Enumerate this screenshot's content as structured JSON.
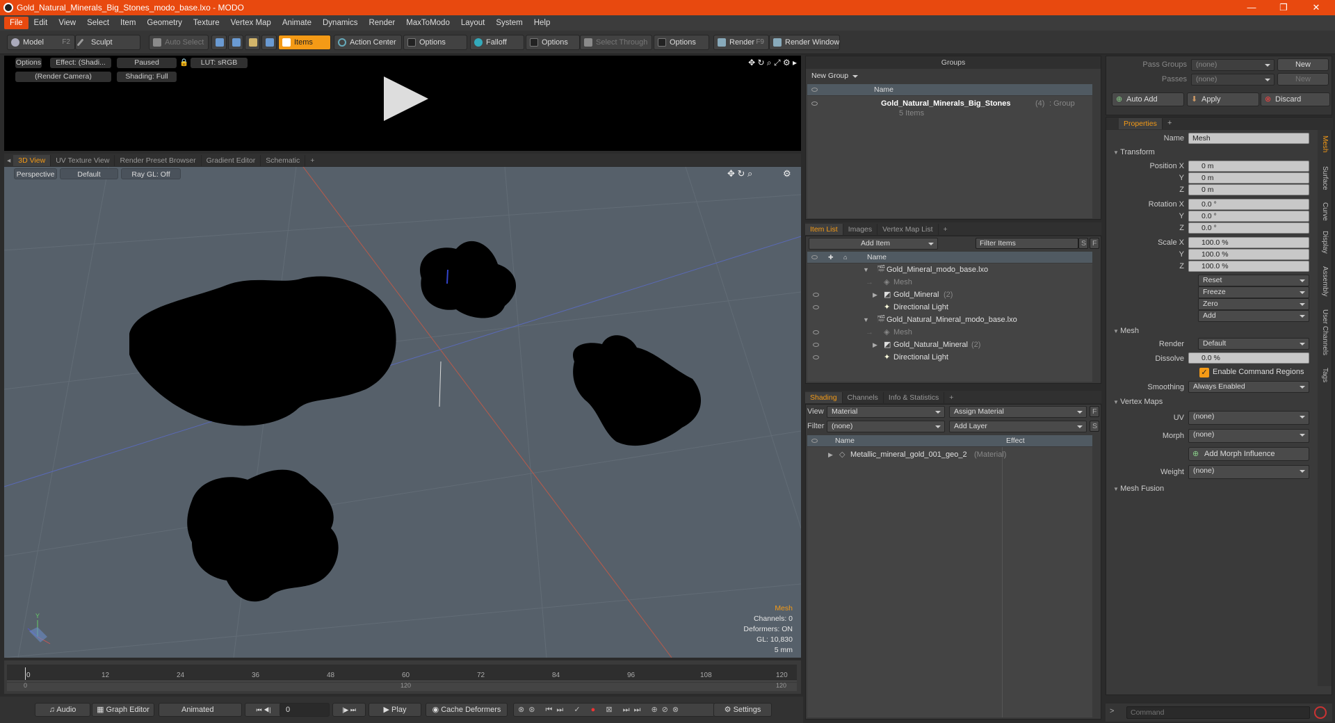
{
  "window": {
    "title": "Gold_Natural_Minerals_Big_Stones_modo_base.lxo - MODO",
    "min": "—",
    "max": "❐",
    "close": "✕"
  },
  "menu": [
    "File",
    "Edit",
    "View",
    "Select",
    "Item",
    "Geometry",
    "Texture",
    "Vertex Map",
    "Animate",
    "Dynamics",
    "Render",
    "MaxToModo",
    "Layout",
    "System",
    "Help"
  ],
  "toolbar": {
    "model": "Model",
    "model_key": "F2",
    "sculpt": "Sculpt",
    "auto_select": "Auto Select",
    "items": "Items",
    "action_center": "Action Center",
    "options1": "Options",
    "falloff": "Falloff",
    "options2": "Options",
    "select_through": "Select Through",
    "options3": "Options",
    "render": "Render",
    "render_key": "F9",
    "render_window": "Render Window"
  },
  "preview": {
    "options": "Options",
    "effect": "Effect: (Shadi...",
    "paused": "Paused",
    "lut": "LUT: sRGB",
    "camera": "(Render Camera)",
    "shading": "Shading: Full"
  },
  "view_tabs": [
    "3D View",
    "UV Texture View",
    "Render Preset Browser",
    "Gradient Editor",
    "Schematic",
    "+"
  ],
  "viewport": {
    "perspective": "Perspective",
    "default": "Default",
    "raygl": "Ray GL: Off",
    "stats": {
      "title": "Mesh",
      "channels": "Channels: 0",
      "deformers": "Deformers: ON",
      "gl": "GL: 10,830",
      "size": "5 mm"
    },
    "axis_y": "Y"
  },
  "timeline": {
    "ticks": [
      "0",
      "12",
      "24",
      "36",
      "48",
      "60",
      "72",
      "84",
      "96",
      "108",
      "120"
    ],
    "sub_start": "0",
    "sub_mid": "120",
    "sub_end": "120"
  },
  "transport": {
    "audio": "Audio",
    "graph_editor": "Graph Editor",
    "animated": "Animated",
    "frame": "0",
    "play": "Play",
    "cache_deformers": "Cache Deformers",
    "settings": "Settings"
  },
  "groups": {
    "title": "Groups",
    "new_group": "New Group",
    "col_name": "Name",
    "item_name": "Gold_Natural_Minerals_Big_Stones",
    "item_count": "(4)",
    "item_type": ": Group",
    "item_sub": "5 Items"
  },
  "itemlist": {
    "tabs": [
      "Item List",
      "Images",
      "Vertex Map List",
      "+"
    ],
    "add_item": "Add Item",
    "filter": "Filter Items",
    "col_name": "Name",
    "btn_s": "S",
    "btn_f": "F",
    "rows": [
      {
        "label": "Gold_Mineral_modo_base.lxo",
        "extra": "",
        "dim": false
      },
      {
        "label": "Mesh",
        "extra": "",
        "dim": true
      },
      {
        "label": "Gold_Mineral",
        "extra": "(2)",
        "dim": false
      },
      {
        "label": "Directional Light",
        "extra": "",
        "dim": false
      },
      {
        "label": "Gold_Natural_Mineral_modo_base.lxo",
        "extra": "",
        "dim": false
      },
      {
        "label": "Mesh",
        "extra": "",
        "dim": true
      },
      {
        "label": "Gold_Natural_Mineral",
        "extra": "(2)",
        "dim": false
      },
      {
        "label": "Directional Light",
        "extra": "",
        "dim": false
      }
    ]
  },
  "shading": {
    "tabs": [
      "Shading",
      "Channels",
      "Info & Statistics",
      "+"
    ],
    "view_label": "View",
    "view_value": "Material",
    "assign": "Assign Material",
    "btn_f": "F",
    "filter_label": "Filter",
    "filter_value": "(none)",
    "add_layer": "Add Layer",
    "btn_s": "S",
    "col_name": "Name",
    "col_effect": "Effect",
    "row": "Metallic_mineral_gold_001_geo_2",
    "row_type": "(Material)"
  },
  "passes": {
    "pass_groups": "Pass Groups",
    "passes": "Passes",
    "none1": "(none)",
    "none2": "(none)",
    "new1": "New",
    "new2": "New",
    "auto_add": "Auto Add",
    "apply": "Apply",
    "discard": "Discard"
  },
  "properties": {
    "tab": "Properties",
    "plus": "+",
    "name_label": "Name",
    "name_value": "Mesh",
    "transform": "Transform",
    "position": [
      {
        "l": "Position X",
        "v": "0 m"
      },
      {
        "l": "Y",
        "v": "0 m"
      },
      {
        "l": "Z",
        "v": "0 m"
      }
    ],
    "rotation": [
      {
        "l": "Rotation X",
        "v": "0.0 °"
      },
      {
        "l": "Y",
        "v": "0.0 °"
      },
      {
        "l": "Z",
        "v": "0.0 °"
      }
    ],
    "scale": [
      {
        "l": "Scale X",
        "v": "100.0 %"
      },
      {
        "l": "Y",
        "v": "100.0 %"
      },
      {
        "l": "Z",
        "v": "100.0 %"
      }
    ],
    "reset": "Reset",
    "freeze": "Freeze",
    "zero": "Zero",
    "add": "Add",
    "mesh": "Mesh",
    "render_label": "Render",
    "render_value": "Default",
    "dissolve_label": "Dissolve",
    "dissolve_value": "0.0 %",
    "enable_cmd": "Enable Command Regions",
    "smoothing_label": "Smoothing",
    "smoothing_value": "Always Enabled",
    "vertex_maps": "Vertex Maps",
    "uv_label": "UV",
    "uv_value": "(none)",
    "morph_label": "Morph",
    "morph_value": "(none)",
    "add_morph": "Add Morph Influence",
    "weight_label": "Weight",
    "weight_value": "(none)",
    "mesh_fusion": "Mesh Fusion",
    "side_tabs": [
      "Mesh",
      "Surface",
      "Curve",
      "Display",
      "Assembly",
      "User Channels",
      "Tags"
    ]
  },
  "command": {
    "placeholder": "Command",
    "prompt": ">"
  },
  "colors": {
    "accent": "#f49a16",
    "title_bar": "#e8490f",
    "viewport": "#56606a"
  }
}
